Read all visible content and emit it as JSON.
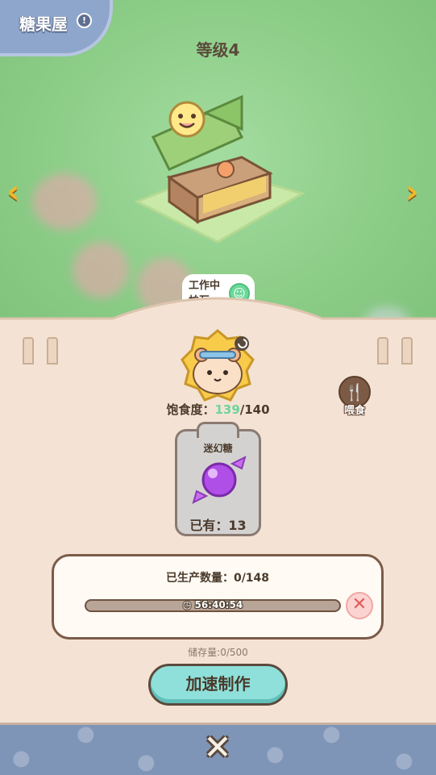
{
  "header": {
    "title": "糖果屋",
    "level": "等级4"
  },
  "worker_bubble": {
    "line1": "工作中",
    "line2": "帕瓦"
  },
  "satiety": {
    "label": "饱食度：",
    "current": "139",
    "max": "/140"
  },
  "feed": {
    "label": "喂食"
  },
  "product": {
    "name": "迷幻糖",
    "owned": "已有：13"
  },
  "production": {
    "label": "已生产数量：0/148",
    "timer": "56:40:54",
    "progress": 0
  },
  "storage": {
    "text": "储存量:0/500"
  },
  "actions": {
    "speed_up": "加速制作"
  },
  "icons": {
    "info": "info-icon",
    "left": "chevron-left-icon",
    "right": "chevron-right-icon",
    "feed": "fork-knife-icon",
    "clock": "clock-icon",
    "cancel": "cancel-icon",
    "close": "close-icon"
  },
  "colors": {
    "accent": "#8fe0da",
    "satiety_current": "#6ed49a",
    "cancel": "#e45a5a",
    "arrow": "#f0b82a"
  }
}
